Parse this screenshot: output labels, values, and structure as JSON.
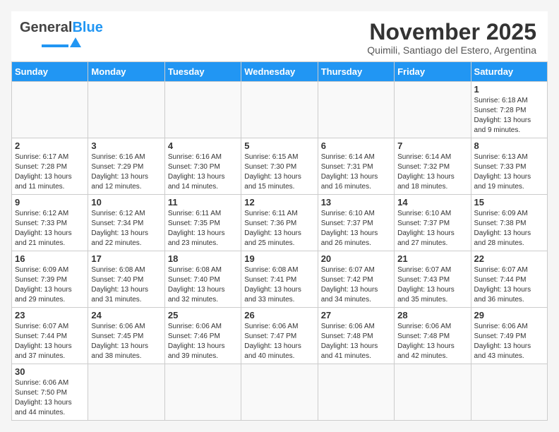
{
  "header": {
    "logo_general": "General",
    "logo_blue": "Blue",
    "month_title": "November 2025",
    "subtitle": "Quimili, Santiago del Estero, Argentina"
  },
  "weekdays": [
    "Sunday",
    "Monday",
    "Tuesday",
    "Wednesday",
    "Thursday",
    "Friday",
    "Saturday"
  ],
  "weeks": [
    [
      {
        "day": "",
        "text": ""
      },
      {
        "day": "",
        "text": ""
      },
      {
        "day": "",
        "text": ""
      },
      {
        "day": "",
        "text": ""
      },
      {
        "day": "",
        "text": ""
      },
      {
        "day": "",
        "text": ""
      },
      {
        "day": "1",
        "text": "Sunrise: 6:18 AM\nSunset: 7:28 PM\nDaylight: 13 hours\nand 9 minutes."
      }
    ],
    [
      {
        "day": "2",
        "text": "Sunrise: 6:17 AM\nSunset: 7:28 PM\nDaylight: 13 hours\nand 11 minutes."
      },
      {
        "day": "3",
        "text": "Sunrise: 6:16 AM\nSunset: 7:29 PM\nDaylight: 13 hours\nand 12 minutes."
      },
      {
        "day": "4",
        "text": "Sunrise: 6:16 AM\nSunset: 7:30 PM\nDaylight: 13 hours\nand 14 minutes."
      },
      {
        "day": "5",
        "text": "Sunrise: 6:15 AM\nSunset: 7:30 PM\nDaylight: 13 hours\nand 15 minutes."
      },
      {
        "day": "6",
        "text": "Sunrise: 6:14 AM\nSunset: 7:31 PM\nDaylight: 13 hours\nand 16 minutes."
      },
      {
        "day": "7",
        "text": "Sunrise: 6:14 AM\nSunset: 7:32 PM\nDaylight: 13 hours\nand 18 minutes."
      },
      {
        "day": "8",
        "text": "Sunrise: 6:13 AM\nSunset: 7:33 PM\nDaylight: 13 hours\nand 19 minutes."
      }
    ],
    [
      {
        "day": "9",
        "text": "Sunrise: 6:12 AM\nSunset: 7:33 PM\nDaylight: 13 hours\nand 21 minutes."
      },
      {
        "day": "10",
        "text": "Sunrise: 6:12 AM\nSunset: 7:34 PM\nDaylight: 13 hours\nand 22 minutes."
      },
      {
        "day": "11",
        "text": "Sunrise: 6:11 AM\nSunset: 7:35 PM\nDaylight: 13 hours\nand 23 minutes."
      },
      {
        "day": "12",
        "text": "Sunrise: 6:11 AM\nSunset: 7:36 PM\nDaylight: 13 hours\nand 25 minutes."
      },
      {
        "day": "13",
        "text": "Sunrise: 6:10 AM\nSunset: 7:37 PM\nDaylight: 13 hours\nand 26 minutes."
      },
      {
        "day": "14",
        "text": "Sunrise: 6:10 AM\nSunset: 7:37 PM\nDaylight: 13 hours\nand 27 minutes."
      },
      {
        "day": "15",
        "text": "Sunrise: 6:09 AM\nSunset: 7:38 PM\nDaylight: 13 hours\nand 28 minutes."
      }
    ],
    [
      {
        "day": "16",
        "text": "Sunrise: 6:09 AM\nSunset: 7:39 PM\nDaylight: 13 hours\nand 29 minutes."
      },
      {
        "day": "17",
        "text": "Sunrise: 6:08 AM\nSunset: 7:40 PM\nDaylight: 13 hours\nand 31 minutes."
      },
      {
        "day": "18",
        "text": "Sunrise: 6:08 AM\nSunset: 7:40 PM\nDaylight: 13 hours\nand 32 minutes."
      },
      {
        "day": "19",
        "text": "Sunrise: 6:08 AM\nSunset: 7:41 PM\nDaylight: 13 hours\nand 33 minutes."
      },
      {
        "day": "20",
        "text": "Sunrise: 6:07 AM\nSunset: 7:42 PM\nDaylight: 13 hours\nand 34 minutes."
      },
      {
        "day": "21",
        "text": "Sunrise: 6:07 AM\nSunset: 7:43 PM\nDaylight: 13 hours\nand 35 minutes."
      },
      {
        "day": "22",
        "text": "Sunrise: 6:07 AM\nSunset: 7:44 PM\nDaylight: 13 hours\nand 36 minutes."
      }
    ],
    [
      {
        "day": "23",
        "text": "Sunrise: 6:07 AM\nSunset: 7:44 PM\nDaylight: 13 hours\nand 37 minutes."
      },
      {
        "day": "24",
        "text": "Sunrise: 6:06 AM\nSunset: 7:45 PM\nDaylight: 13 hours\nand 38 minutes."
      },
      {
        "day": "25",
        "text": "Sunrise: 6:06 AM\nSunset: 7:46 PM\nDaylight: 13 hours\nand 39 minutes."
      },
      {
        "day": "26",
        "text": "Sunrise: 6:06 AM\nSunset: 7:47 PM\nDaylight: 13 hours\nand 40 minutes."
      },
      {
        "day": "27",
        "text": "Sunrise: 6:06 AM\nSunset: 7:48 PM\nDaylight: 13 hours\nand 41 minutes."
      },
      {
        "day": "28",
        "text": "Sunrise: 6:06 AM\nSunset: 7:48 PM\nDaylight: 13 hours\nand 42 minutes."
      },
      {
        "day": "29",
        "text": "Sunrise: 6:06 AM\nSunset: 7:49 PM\nDaylight: 13 hours\nand 43 minutes."
      }
    ],
    [
      {
        "day": "30",
        "text": "Sunrise: 6:06 AM\nSunset: 7:50 PM\nDaylight: 13 hours\nand 44 minutes."
      },
      {
        "day": "",
        "text": ""
      },
      {
        "day": "",
        "text": ""
      },
      {
        "day": "",
        "text": ""
      },
      {
        "day": "",
        "text": ""
      },
      {
        "day": "",
        "text": ""
      },
      {
        "day": "",
        "text": ""
      }
    ]
  ]
}
